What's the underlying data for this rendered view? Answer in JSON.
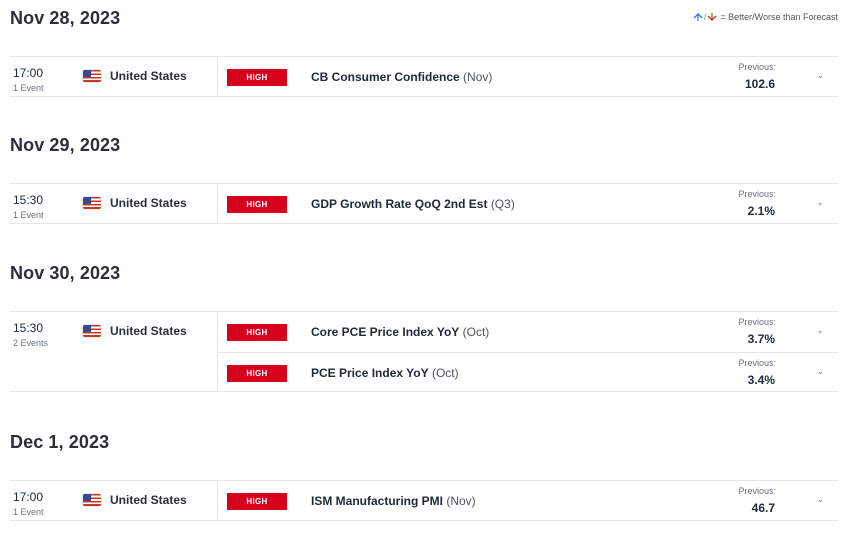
{
  "legend": {
    "up_icon": "arrow-up-icon",
    "down_icon": "arrow-down-icon",
    "separator": "/",
    "text": "= Better/Worse than Forecast"
  },
  "days": [
    {
      "date": "Nov 28, 2023",
      "time": "17:00",
      "count": "1 Event",
      "country": "United States",
      "flag": "us-flag-icon",
      "events": [
        {
          "impact": "HIGH",
          "name": "CB Consumer Confidence",
          "period": "(Nov)",
          "previous_label": "Previous:",
          "previous": "102.6"
        }
      ]
    },
    {
      "date": "Nov 29, 2023",
      "time": "15:30",
      "count": "1 Event",
      "country": "United States",
      "flag": "us-flag-icon",
      "events": [
        {
          "impact": "HIGH",
          "name": "GDP Growth Rate QoQ 2nd Est",
          "period": "(Q3)",
          "previous_label": "Previous:",
          "previous": "2.1%"
        }
      ]
    },
    {
      "date": "Nov 30, 2023",
      "time": "15:30",
      "count": "2 Events",
      "country": "United States",
      "flag": "us-flag-icon",
      "events": [
        {
          "impact": "HIGH",
          "name": "Core PCE Price Index YoY",
          "period": "(Oct)",
          "previous_label": "Previous:",
          "previous": "3.7%"
        },
        {
          "impact": "HIGH",
          "name": "PCE Price Index YoY",
          "period": "(Oct)",
          "previous_label": "Previous:",
          "previous": "3.4%"
        }
      ]
    },
    {
      "date": "Dec 1, 2023",
      "time": "17:00",
      "count": "1 Event",
      "country": "United States",
      "flag": "us-flag-icon",
      "events": [
        {
          "impact": "HIGH",
          "name": "ISM Manufacturing PMI",
          "period": "(Nov)",
          "previous_label": "Previous:",
          "previous": "46.7"
        }
      ]
    }
  ],
  "colors": {
    "impact_high": "#d6001c",
    "better": "#2a7fd4",
    "worse": "#c0392b"
  }
}
